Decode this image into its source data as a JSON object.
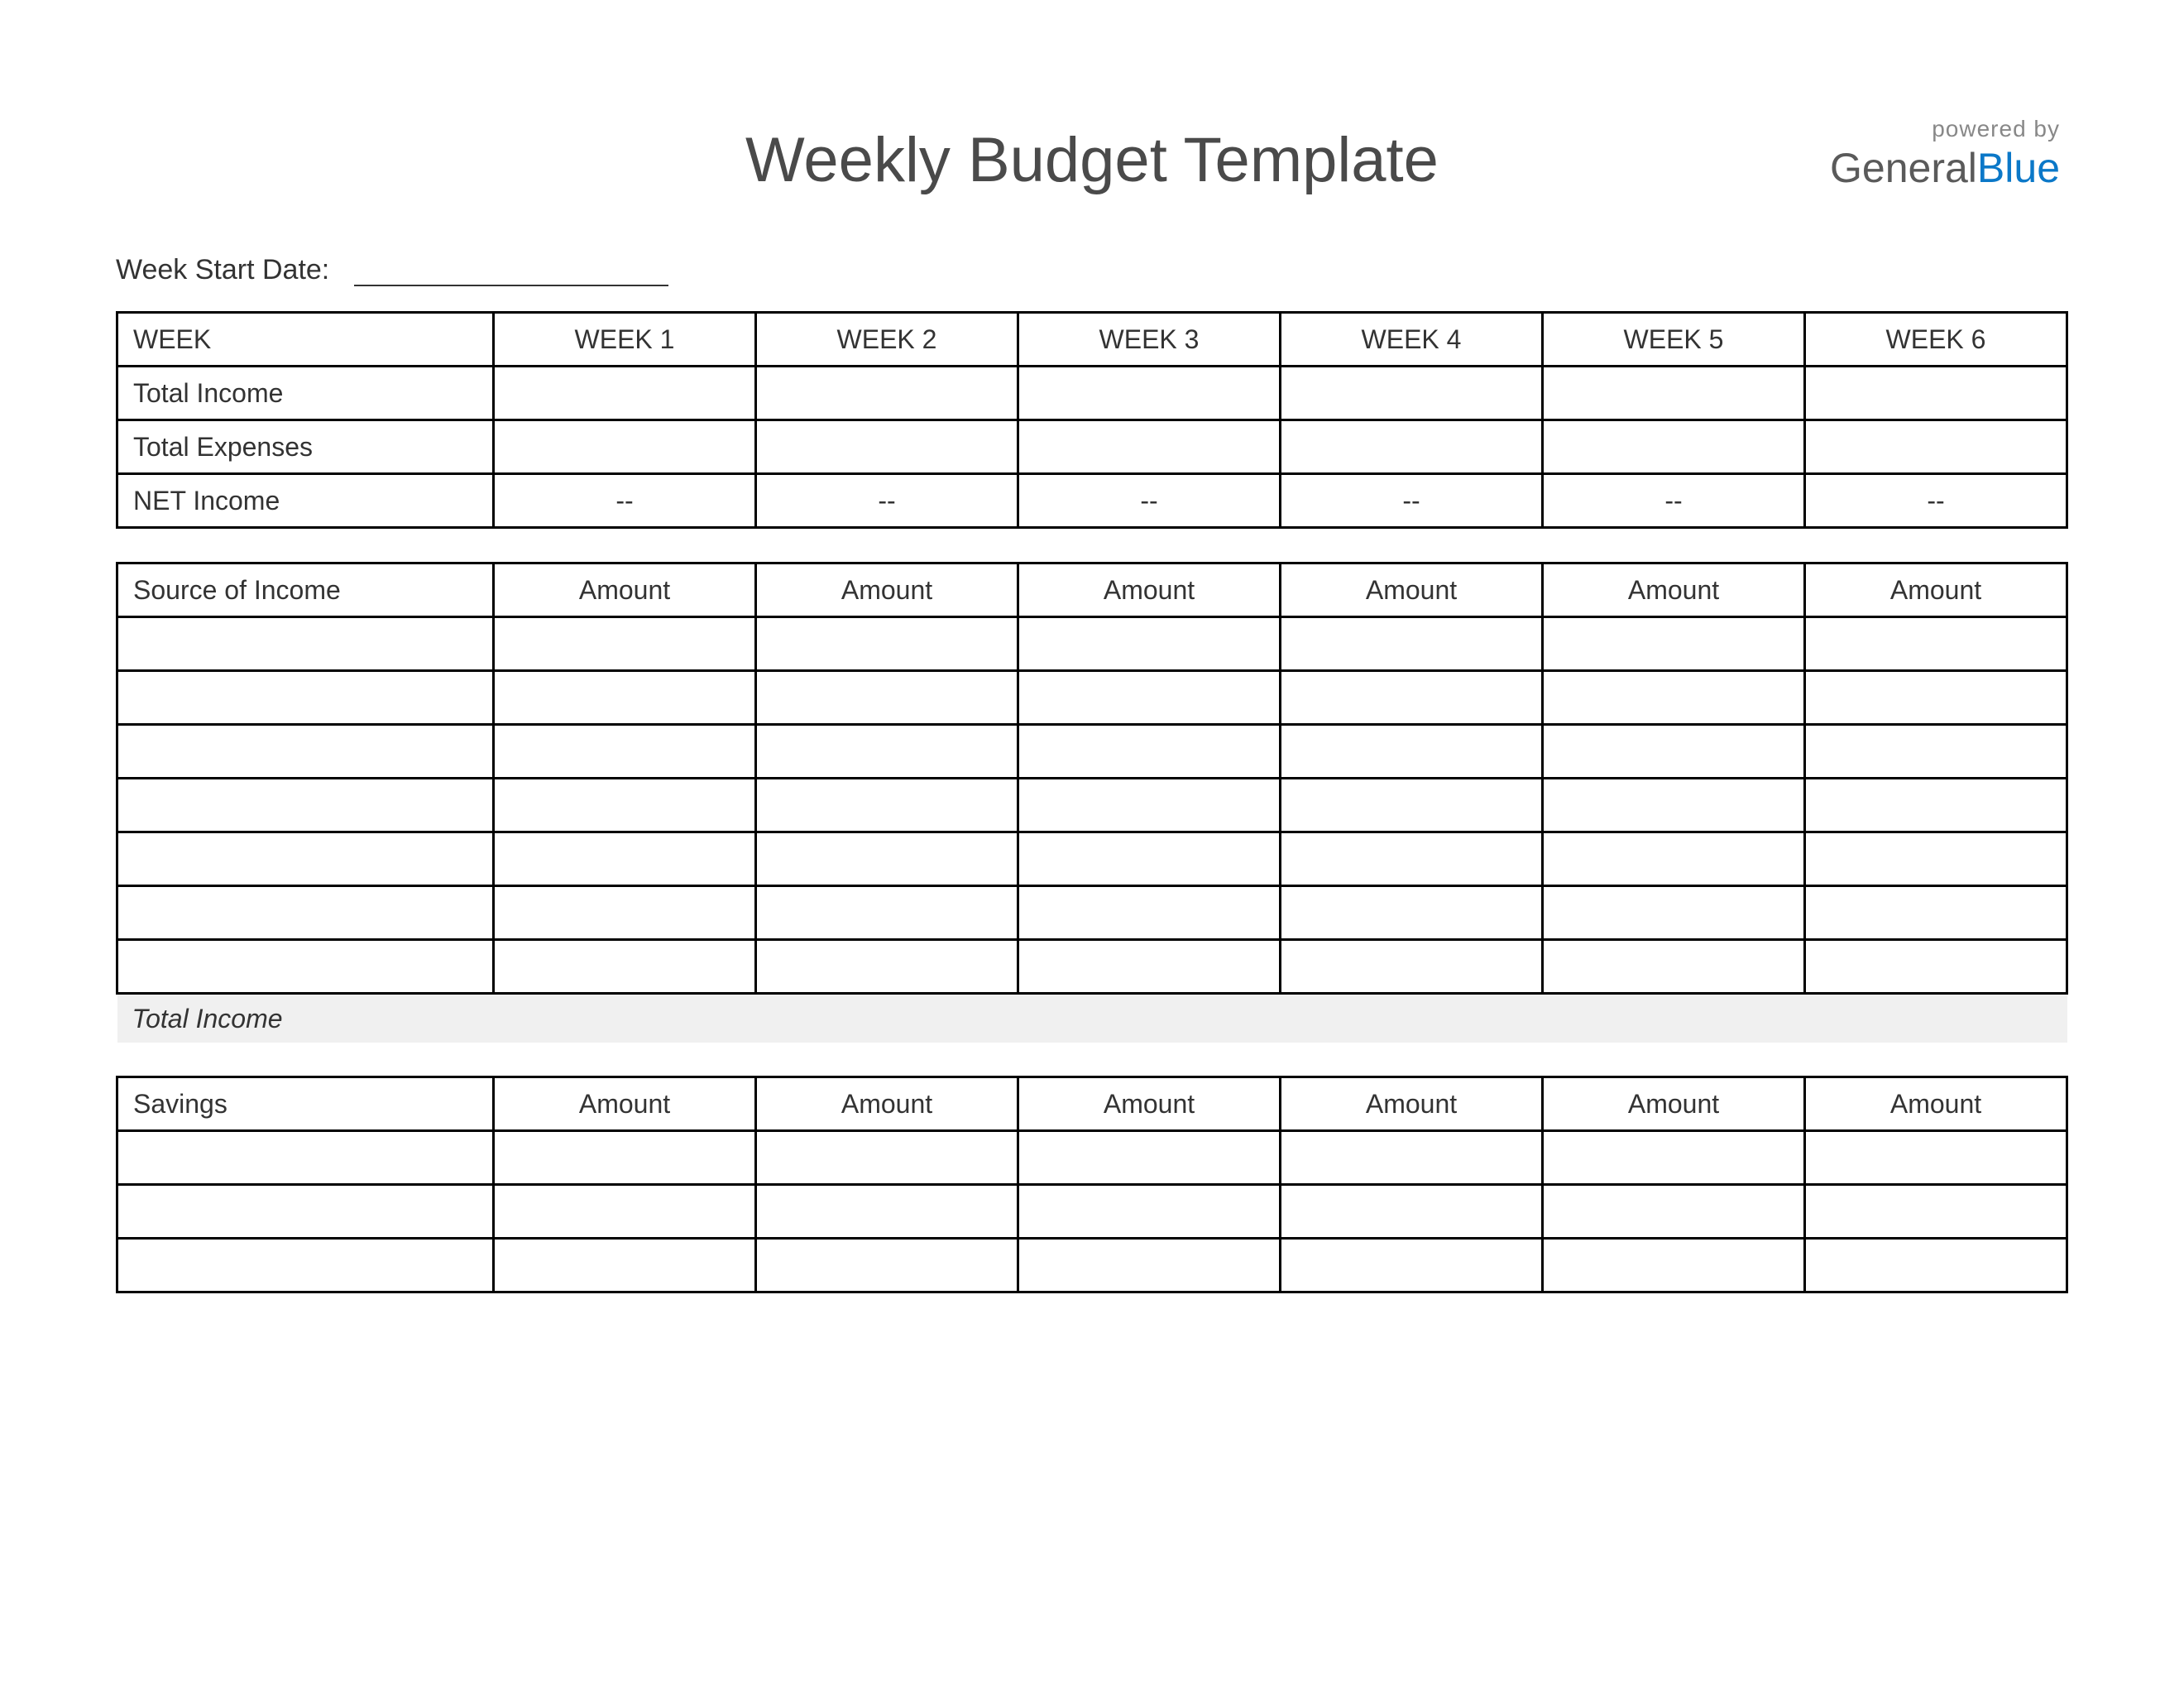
{
  "header": {
    "title": "Weekly Budget Template",
    "brand_top": "powered by",
    "brand_general": "General",
    "brand_blue": "Blue"
  },
  "start": {
    "label": "Week Start Date:",
    "value": ""
  },
  "summary": {
    "header_first": "WEEK",
    "weeks": [
      "WEEK 1",
      "WEEK 2",
      "WEEK 3",
      "WEEK 4",
      "WEEK 5",
      "WEEK 6"
    ],
    "rows": [
      {
        "label": "Total Income",
        "values": [
          "",
          "",
          "",
          "",
          "",
          ""
        ]
      },
      {
        "label": "Total Expenses",
        "values": [
          "",
          "",
          "",
          "",
          "",
          ""
        ]
      },
      {
        "label": "NET Income",
        "values": [
          "--",
          "--",
          "--",
          "--",
          "--",
          "--"
        ]
      }
    ]
  },
  "income": {
    "header_first": "Source of Income",
    "amount_headers": [
      "Amount",
      "Amount",
      "Amount",
      "Amount",
      "Amount",
      "Amount"
    ],
    "row_count": 7,
    "total_label": "Total Income"
  },
  "savings": {
    "header_first": "Savings",
    "amount_headers": [
      "Amount",
      "Amount",
      "Amount",
      "Amount",
      "Amount",
      "Amount"
    ],
    "row_count": 3
  }
}
